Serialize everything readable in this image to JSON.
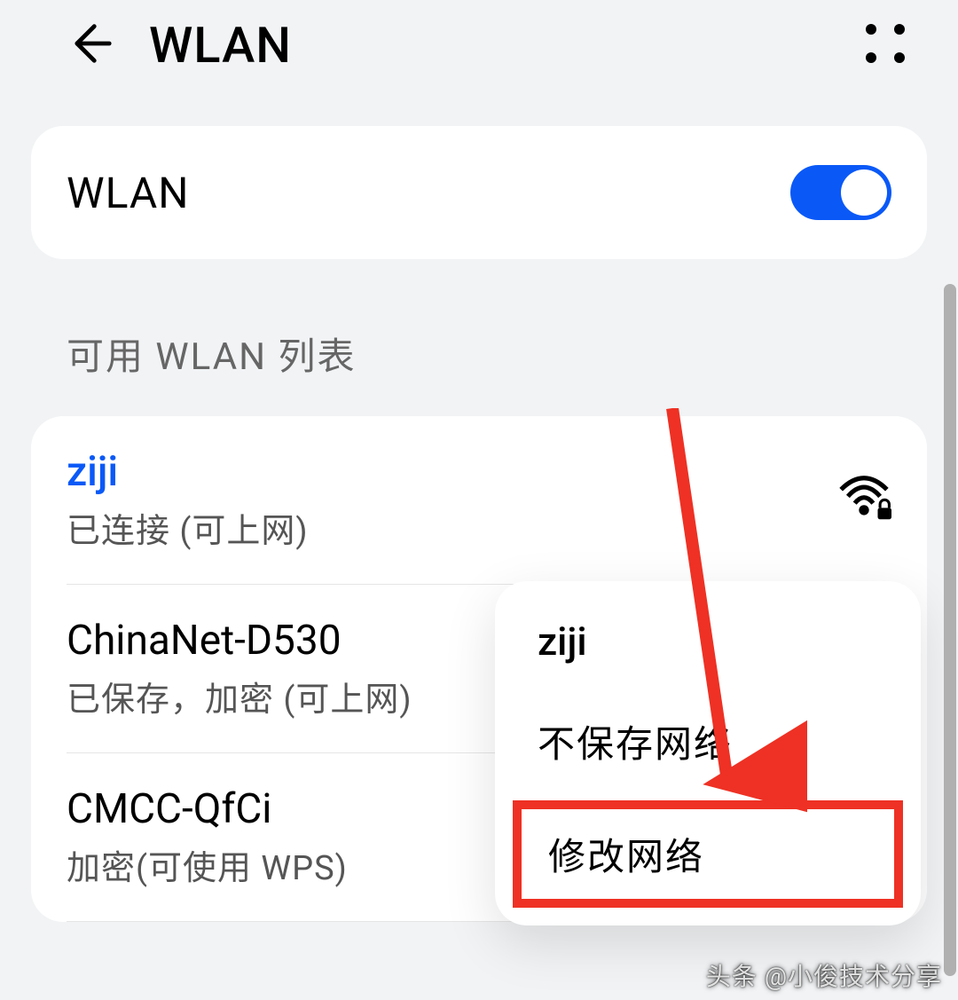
{
  "header": {
    "title": "WLAN"
  },
  "toggle": {
    "label": "WLAN",
    "enabled": true
  },
  "section": {
    "title": "可用 WLAN 列表"
  },
  "networks": [
    {
      "name": "ziji",
      "status": "已连接 (可上网)",
      "connected": true
    },
    {
      "name": "ChinaNet-D530",
      "status": "已保存，加密 (可上网)",
      "connected": false
    },
    {
      "name": "CMCC-QfCi",
      "status": "加密(可使用 WPS)",
      "connected": false
    }
  ],
  "popup": {
    "title": "ziji",
    "items": [
      "不保存网络",
      "修改网络"
    ]
  },
  "watermark": "头条 @小俊技术分享"
}
